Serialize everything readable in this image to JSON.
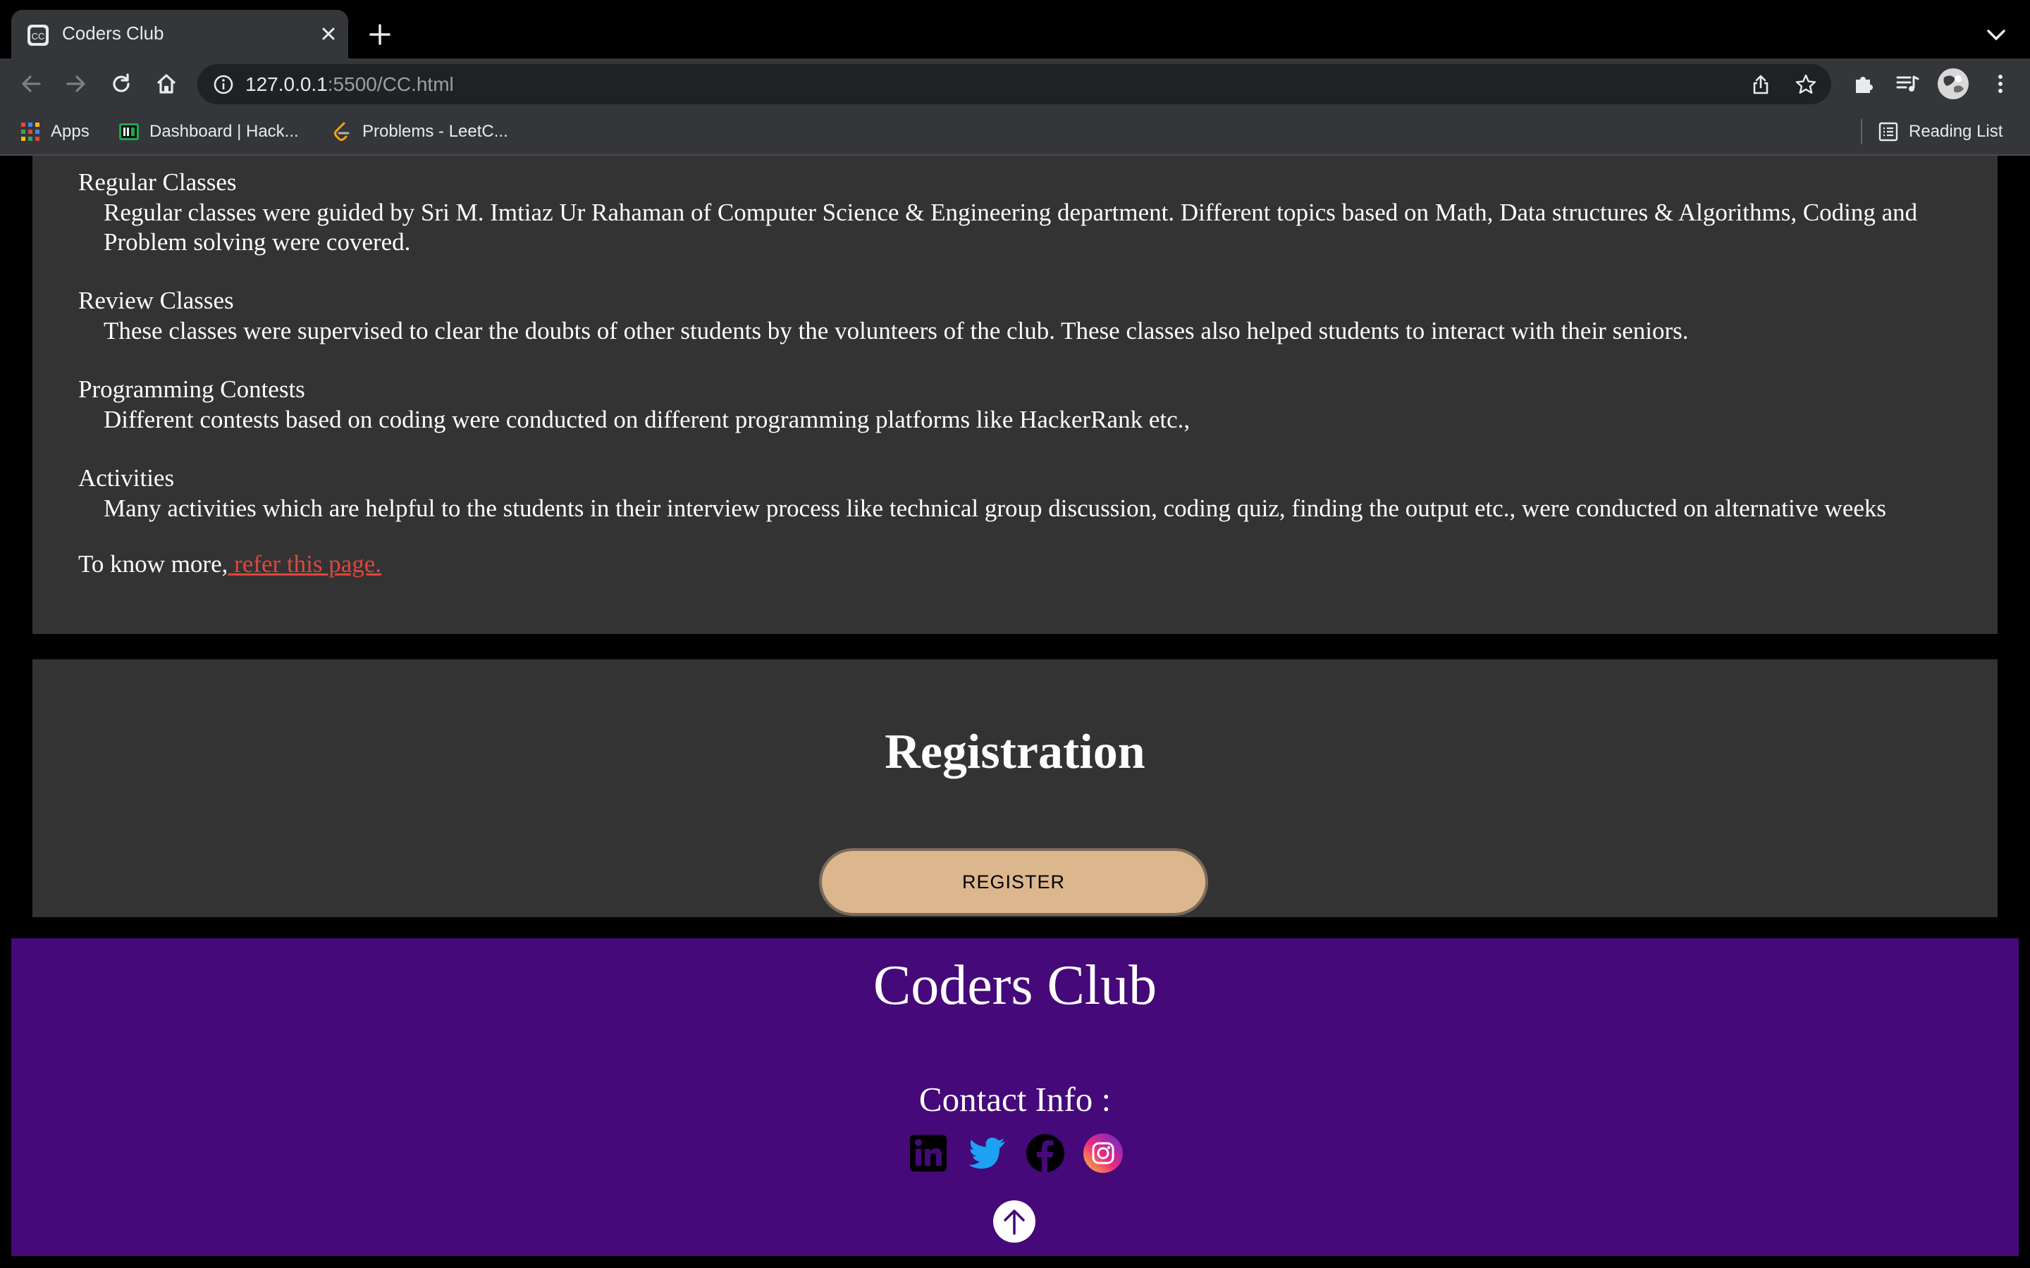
{
  "browser": {
    "tab_title": "Coders Club",
    "url_host": "127.0.0.1",
    "url_path": ":5500/CC.html",
    "bookmarks": [
      {
        "label": "Apps",
        "icon": "apps-grid-icon"
      },
      {
        "label": "Dashboard | Hack...",
        "icon": "hackerrank-icon"
      },
      {
        "label": "Problems - LeetC...",
        "icon": "leetcode-icon"
      }
    ],
    "reading_list": "Reading List"
  },
  "activities": [
    {
      "title": "Regular Classes",
      "body": "Regular classes were guided by Sri M. Imtiaz Ur Rahaman of Computer Science & Engineering department. Different topics based on Math, Data structures & Algorithms, Coding and Problem solving were covered."
    },
    {
      "title": "Review Classes",
      "body": "These classes were supervised to clear the doubts of other students by the volunteers of the club. These classes also helped students to interact with their seniors."
    },
    {
      "title": "Programming Contests",
      "body": "Different contests based on coding were conducted on different programming platforms like HackerRank etc.,"
    },
    {
      "title": "Activities",
      "body": "Many activities which are helpful to the students in their interview process like technical group discussion, coding quiz, finding the output etc., were conducted on alternative weeks"
    }
  ],
  "know_more": {
    "prefix": "To know more,",
    "link": " refer this page."
  },
  "registration": {
    "title": "Registration",
    "button": "REGISTER"
  },
  "footer": {
    "title": "Coders Club",
    "contact": "Contact Info :",
    "socials": [
      "linkedin-icon",
      "twitter-icon",
      "facebook-icon",
      "instagram-icon"
    ]
  },
  "colors": {
    "section_bg": "#333333",
    "footer_bg": "#45097a",
    "button_bg": "#dcb78e",
    "link": "#e0463d"
  }
}
